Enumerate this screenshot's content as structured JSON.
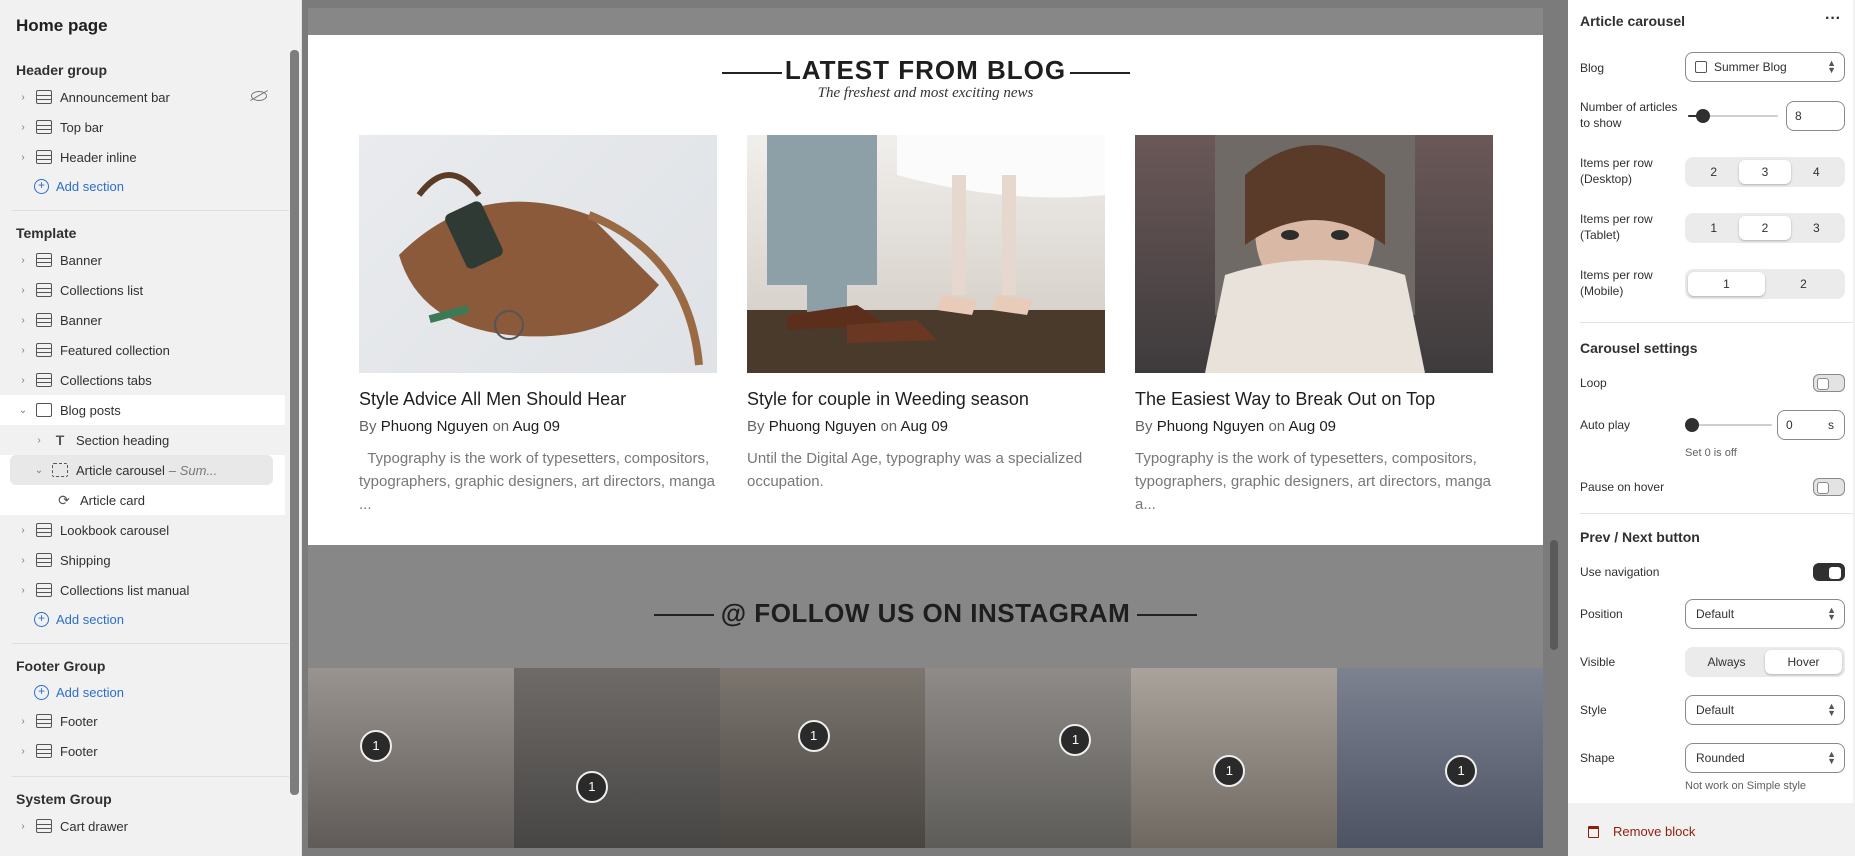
{
  "left": {
    "title": "Home page",
    "header_group": {
      "label": "Header group",
      "items": [
        "Announcement bar",
        "Top bar",
        "Header inline"
      ],
      "add": "Add section"
    },
    "template": {
      "label": "Template",
      "items": [
        "Banner",
        "Collections list",
        "Banner",
        "Featured collection",
        "Collections tabs"
      ],
      "selected": "Blog posts",
      "children": {
        "section_heading": "Section heading",
        "article_carousel": "Article carousel",
        "article_carousel_suffix": "– Sum...",
        "article_card": "Article card"
      },
      "after": [
        "Lookbook carousel",
        "Shipping",
        "Collections list manual"
      ],
      "add": "Add section"
    },
    "footer_group": {
      "label": "Footer Group",
      "add": "Add section",
      "items": [
        "Footer",
        "Footer"
      ]
    },
    "system_group": {
      "label": "System Group",
      "items": [
        "Cart drawer"
      ]
    }
  },
  "preview": {
    "blog_title": "LATEST FROM BLOG",
    "blog_subtitle": "The freshest and most exciting news",
    "cards": [
      {
        "title": "Style Advice All Men Should Hear",
        "by": "By",
        "author": "Phuong Nguyen",
        "on": "on",
        "date": "Aug 09",
        "excerpt": "  Typography is the work of typesetters, compositors, typographers, graphic designers, art directors, manga ..."
      },
      {
        "title": "Style for couple in Weeding season",
        "by": "By",
        "author": "Phuong Nguyen",
        "on": "on",
        "date": "Aug 09",
        "excerpt": "Until the Digital Age, typography was a specialized occupation."
      },
      {
        "title": "The Easiest Way to Break Out on Top",
        "by": "By",
        "author": "Phuong Nguyen",
        "on": "on",
        "date": "Aug 09",
        "excerpt": "Typography is the work of typesetters, compositors, typographers, graphic designers, art directors, manga a..."
      }
    ],
    "instagram_title": "@ FOLLOW US ON INSTAGRAM",
    "pin_label": "1"
  },
  "panel": {
    "title": "Article carousel",
    "more_icon": "more-horizontal-icon",
    "blog_label": "Blog",
    "blog_value": "Summer Blog",
    "num_articles_label": "Number of articles to show",
    "num_articles_value": "8",
    "desktop_label": "Items per row (Desktop)",
    "desktop_options": [
      "2",
      "3",
      "4"
    ],
    "tablet_label": "Items per row (Tablet)",
    "tablet_options": [
      "1",
      "2",
      "3"
    ],
    "mobile_label": "Items per row (Mobile)",
    "mobile_options": [
      "1",
      "2"
    ],
    "carousel_heading": "Carousel settings",
    "loop_label": "Loop",
    "autoplay_label": "Auto play",
    "autoplay_value": "0",
    "autoplay_unit": "s",
    "autoplay_help": "Set 0 is off",
    "pause_label": "Pause on hover",
    "nav_heading": "Prev / Next button",
    "use_nav_label": "Use navigation",
    "position_label": "Position",
    "position_value": "Default",
    "visible_label": "Visible",
    "visible_options": [
      "Always",
      "Hover"
    ],
    "style_label": "Style",
    "style_value": "Default",
    "shape_label": "Shape",
    "shape_value": "Rounded",
    "shape_help": "Not work on Simple style",
    "remove_label": "Remove block"
  }
}
